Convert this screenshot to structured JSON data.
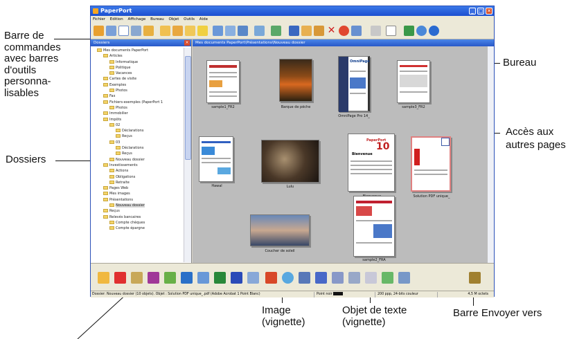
{
  "window": {
    "title": "PaperPort"
  },
  "menu": [
    "Fichier",
    "Edition",
    "Affichage",
    "Bureau",
    "Objet",
    "Outils",
    "Aide"
  ],
  "folders_panel": {
    "title": "Dossiers",
    "tree": [
      "Mes documents PaperPort",
      "Articles",
      "Informatique",
      "Politique",
      "Vacances",
      "Cartes de visite",
      "Exemples",
      "Photos",
      "Fax",
      "Fichiers-exemples (PaperPort 1",
      "Photos",
      "Immobilier",
      "Impôts",
      "02",
      "Déclarations",
      "Reçus",
      "03",
      "Déclarations",
      "Reçus",
      "Nouveau dossier",
      "Investissements",
      "Actions",
      "Obligations",
      "Retraite",
      "Pages Web",
      "Mes images",
      "Présentations",
      "Nouveau dossier",
      "Reçus",
      "Relevés bancaires",
      "Compte chèques",
      "Compte épargne"
    ]
  },
  "desktop": {
    "path": "Mes documents PaperPort\\Présentations\\Nouveau dossier",
    "items": [
      "sample1_FR2",
      "Barque de pêche",
      "OmniPage Pro 14_",
      "sample3_FR2",
      "Hawaï",
      "Lulu",
      "Bienvenue",
      "Solution PDF unique_",
      "Coucher de soleil",
      "sample2_FRA"
    ],
    "omnipage_heading": "OmniPage",
    "paperport_logo": "PaperPort",
    "paperport_version": "10",
    "bienvenue_heading": "Bienvenue"
  },
  "status": {
    "left": "Dossier: Nouveau dossier (10 objets). Objet : Solution PDF unique_.pdf (Adobe Acrobat 1 Point Blanc)",
    "mid": "Point noir",
    "res": "200 ppp, 24-bits couleur",
    "size": "4,5 M octets"
  },
  "callouts": {
    "commands": "Barre de\ncommandes\navec barres\nd'outils\npersonna-\nlisables",
    "bureau": "Bureau",
    "pages": "Accès aux\nautres pages",
    "dossiers": "Dossiers",
    "image": "Image\n(vignette)",
    "texte": "Objet de texte\n(vignette)",
    "envoyer": "Barre Envoyer vers"
  }
}
